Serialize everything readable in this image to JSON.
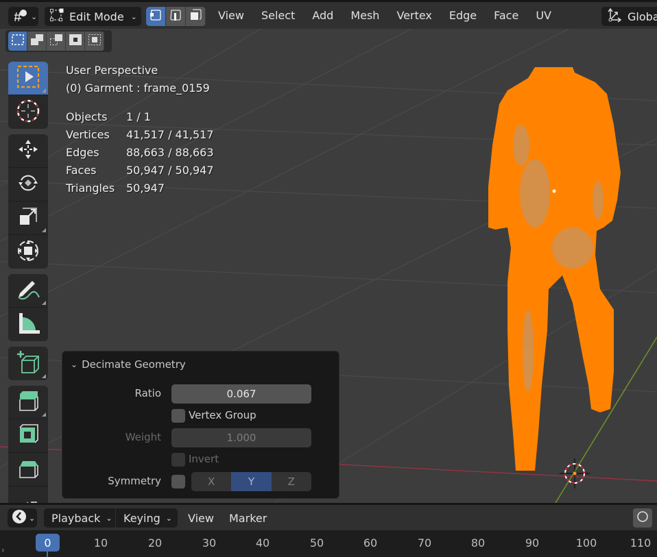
{
  "header": {
    "editor_type_icon": "viewport-3d-icon",
    "mode": "Edit Mode",
    "select_modes": [
      {
        "name": "vertex-select",
        "active": true
      },
      {
        "name": "edge-select",
        "active": false
      },
      {
        "name": "face-select",
        "active": false
      }
    ],
    "menu": [
      "View",
      "Select",
      "Add",
      "Mesh",
      "Vertex",
      "Edge",
      "Face",
      "UV"
    ],
    "orientation": "Global"
  },
  "viewport": {
    "view_name": "User Perspective",
    "object_info": "(0) Garment : frame_0159",
    "stats": [
      {
        "label": "Objects",
        "value": "1 / 1"
      },
      {
        "label": "Vertices",
        "value": "41,517 / 41,517"
      },
      {
        "label": "Edges",
        "value": "88,663 / 88,663"
      },
      {
        "label": "Faces",
        "value": "50,947 / 50,947"
      },
      {
        "label": "Triangles",
        "value": "50,947"
      }
    ],
    "selection_color": "#ff8000",
    "x_axis_color": "#963343",
    "y_axis_color": "#6b8f2c"
  },
  "toolbar": {
    "tools": [
      "select-box",
      "cursor",
      "move",
      "rotate",
      "scale",
      "transform",
      "annotate",
      "measure",
      "add-cube",
      "extrude-region",
      "inset-faces",
      "bevel",
      "loop-cut"
    ]
  },
  "redo_panel": {
    "title": "Decimate Geometry",
    "ratio_label": "Ratio",
    "ratio_value": "0.067",
    "vertex_group_label": "Vertex Group",
    "vertex_group_checked": false,
    "weight_label": "Weight",
    "weight_value": "1.000",
    "invert_label": "Invert",
    "invert_checked": false,
    "symmetry_label": "Symmetry",
    "symmetry_checked": false,
    "axes": [
      "X",
      "Y",
      "Z"
    ],
    "active_axis": "Y"
  },
  "timeline": {
    "playback_label": "Playback",
    "keying_label": "Keying",
    "view_label": "View",
    "marker_label": "Marker",
    "current_frame": "0",
    "ticks": [
      "10",
      "20",
      "30",
      "40",
      "50",
      "60",
      "70",
      "80",
      "90",
      "100",
      "110"
    ]
  }
}
